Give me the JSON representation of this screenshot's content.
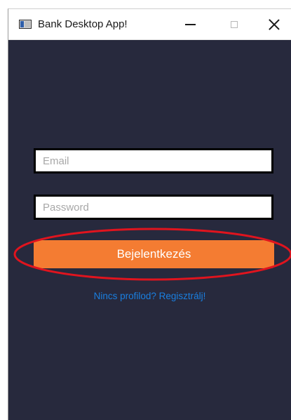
{
  "window": {
    "title": "Bank Desktop App!",
    "icon": "app-window-icon",
    "controls": {
      "minimize_icon": "minimize-icon",
      "maximize_icon": "maximize-icon",
      "close_icon": "close-icon"
    },
    "background_color": "#27293d"
  },
  "login_form": {
    "email_placeholder": "Email",
    "email_value": "",
    "password_placeholder": "Password",
    "password_value": "",
    "login_button_label": "Bejelentkezés",
    "register_link_text": "Nincs profilod? Regisztrálj!",
    "accent_color": "#f47c32",
    "link_color": "#1a7fe0"
  },
  "annotation": {
    "shape": "ellipse",
    "color": "#e0141e",
    "highlights": "login-button"
  }
}
